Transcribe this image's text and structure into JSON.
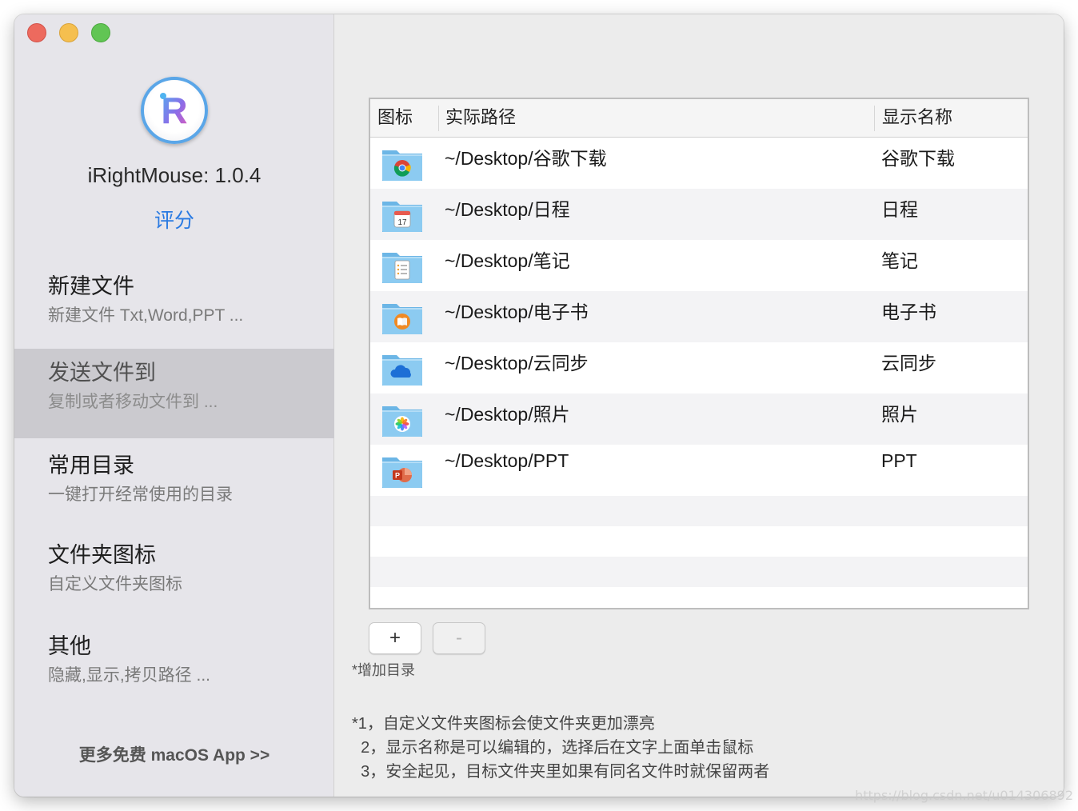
{
  "sidebar": {
    "app_name": "iRightMouse: 1.0.4",
    "rate_label": "评分",
    "logo_letter": "R",
    "items": [
      {
        "title": "新建文件",
        "subtitle": "新建文件 Txt,Word,PPT ..."
      },
      {
        "title": "发送文件到",
        "subtitle": "复制或者移动文件到 ..."
      },
      {
        "title": "常用目录",
        "subtitle": "一键打开经常使用的目录"
      },
      {
        "title": "文件夹图标",
        "subtitle": "自定义文件夹图标"
      },
      {
        "title": "其他",
        "subtitle": "隐藏,显示,拷贝路径 ..."
      }
    ],
    "selected_index": 1,
    "more_link": "更多免费 macOS App >>"
  },
  "table": {
    "headers": [
      "图标",
      "实际路径",
      "显示名称"
    ],
    "rows": [
      {
        "icon": "chrome-folder-icon",
        "path": "~/Desktop/谷歌下载",
        "name": "谷歌下载"
      },
      {
        "icon": "calendar-folder-icon",
        "path": "~/Desktop/日程",
        "name": "日程"
      },
      {
        "icon": "notes-folder-icon",
        "path": "~/Desktop/笔记",
        "name": "笔记"
      },
      {
        "icon": "books-folder-icon",
        "path": "~/Desktop/电子书",
        "name": "电子书"
      },
      {
        "icon": "cloud-folder-icon",
        "path": "~/Desktop/云同步",
        "name": "云同步"
      },
      {
        "icon": "photos-folder-icon",
        "path": "~/Desktop/照片",
        "name": "照片"
      },
      {
        "icon": "powerpoint-folder-icon",
        "path": "~/Desktop/PPT",
        "name": "PPT"
      }
    ],
    "calendar_day": "17"
  },
  "buttons": {
    "add": "+",
    "remove": "-"
  },
  "hint": "*增加目录",
  "notes": [
    "*1，自定义文件夹图标会使文件夹更加漂亮",
    "  2，显示名称是可以编辑的，选择后在文字上面单击鼠标",
    "  3，安全起见，目标文件夹里如果有同名文件时就保留两者"
  ],
  "watermark": "https://blog.csdn.net/u014306892",
  "colors": {
    "accent": "#2a7ae2",
    "selected_bg": "#cbcacf",
    "folder": "#7cc0ec"
  }
}
